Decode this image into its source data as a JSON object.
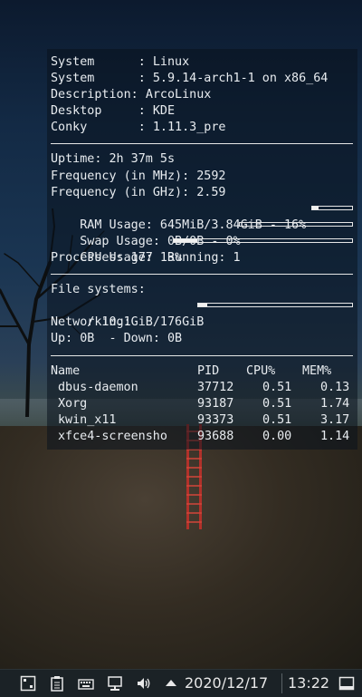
{
  "conky": {
    "system_info": [
      {
        "label": "System      : ",
        "value": "Linux"
      },
      {
        "label": "System      : ",
        "value": "5.9.14-arch1-1 on x86_64"
      },
      {
        "label": "Description: ",
        "value": "ArcoLinux"
      },
      {
        "label": "Desktop     : ",
        "value": "KDE"
      },
      {
        "label": "Conky       : ",
        "value": "1.11.3_pre"
      }
    ],
    "uptime": "Uptime: 2h 37m 5s",
    "freq_mhz": "Frequency (in MHz): 2592",
    "freq_ghz": "Frequency (in GHz): 2.59",
    "ram_usage": "RAM Usage: 645MiB/3.84GiB - 16%",
    "ram_percent": 16,
    "swap_usage": "Swap Usage: 0B/0B - 0%",
    "swap_percent": 0,
    "cpu_usage": "CPU Usage: 13%",
    "cpu_percent": 13,
    "processes": "Processes: 177  Running: 1",
    "filesystems_title": "File systems:",
    "root_fs": " / 10.1GiB/176GiB",
    "root_fs_percent": 6,
    "networking_title": "Networking:",
    "network": "Up: 0B  - Down: 0B",
    "process_table": {
      "headers": [
        "Name",
        "PID",
        "CPU%",
        "MEM%"
      ],
      "rows": [
        [
          "dbus-daemon",
          "37712",
          "0.51",
          "0.13"
        ],
        [
          "Xorg",
          "93187",
          "0.51",
          "1.74"
        ],
        [
          "kwin_x11",
          "93373",
          "0.51",
          "3.17"
        ],
        [
          "xfce4-screensho",
          "93688",
          "0.00",
          "1.14"
        ]
      ]
    }
  },
  "taskbar": {
    "date": "2020/12/17",
    "time": "13:22",
    "icons": [
      "app-launcher-icon",
      "clipboard-icon",
      "keyboard-icon",
      "network-icon",
      "volume-icon",
      "tray-expand-icon",
      "show-desktop-icon"
    ]
  }
}
